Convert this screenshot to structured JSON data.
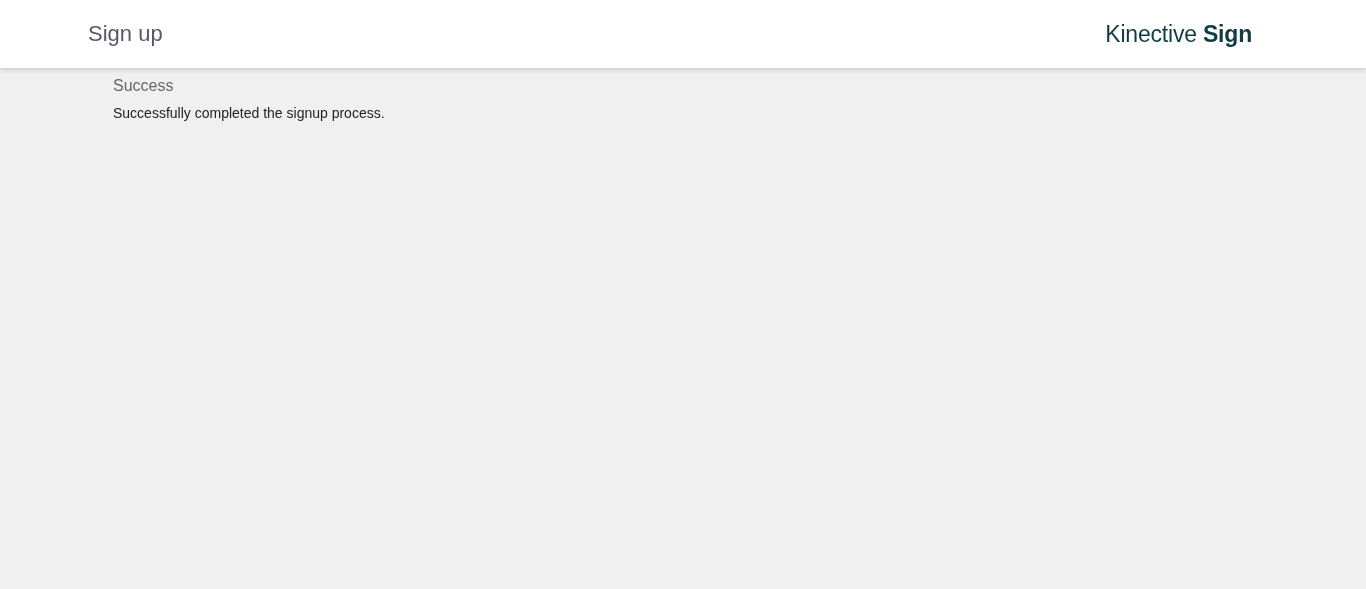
{
  "header": {
    "title": "Sign up",
    "logo": "Kinective **Sign**"
  },
  "message": {
    "heading": "Success",
    "text": "Successfully completed the signup process."
  }
}
